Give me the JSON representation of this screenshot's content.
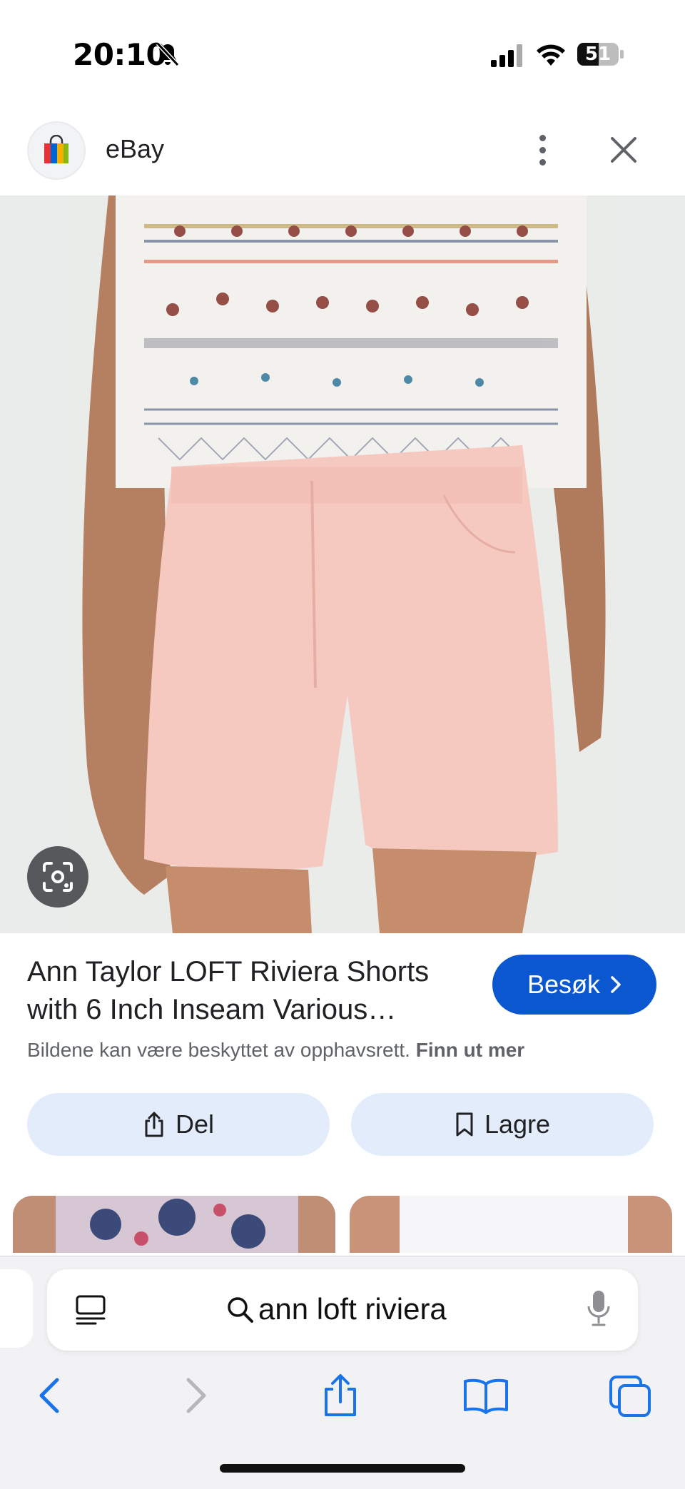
{
  "status_bar": {
    "time": "20:10",
    "battery": "51"
  },
  "header": {
    "site_name": "eBay"
  },
  "product": {
    "title": "Ann Taylor LOFT Riviera Shorts with 6 Inch Inseam Various…",
    "visit_label": "Besøk",
    "copyright_text": "Bildene kan være beskyttet av opphavsrett.",
    "learn_more": "Finn ut mer"
  },
  "actions": {
    "share_label": "Del",
    "save_label": "Lagre"
  },
  "browser": {
    "url_text": "ann loft riviera"
  },
  "colors": {
    "accent": "#0b57d0",
    "action_button_bg": "#e3ecfb",
    "shorts_pink": "#f6c9c0",
    "toolbar_icon": "#1a73e8"
  },
  "icons": {
    "logo": "ebay-bag-icon",
    "more": "more-vert-icon",
    "close": "close-icon",
    "lens": "lens-icon",
    "share": "share-icon",
    "save": "bookmark-icon",
    "reader": "reader-icon",
    "search": "search-icon",
    "mic": "mic-icon",
    "back": "back-icon",
    "forward": "forward-icon",
    "share_toolbar": "share-icon",
    "bookmarks": "book-icon",
    "tabs": "tabs-icon"
  }
}
